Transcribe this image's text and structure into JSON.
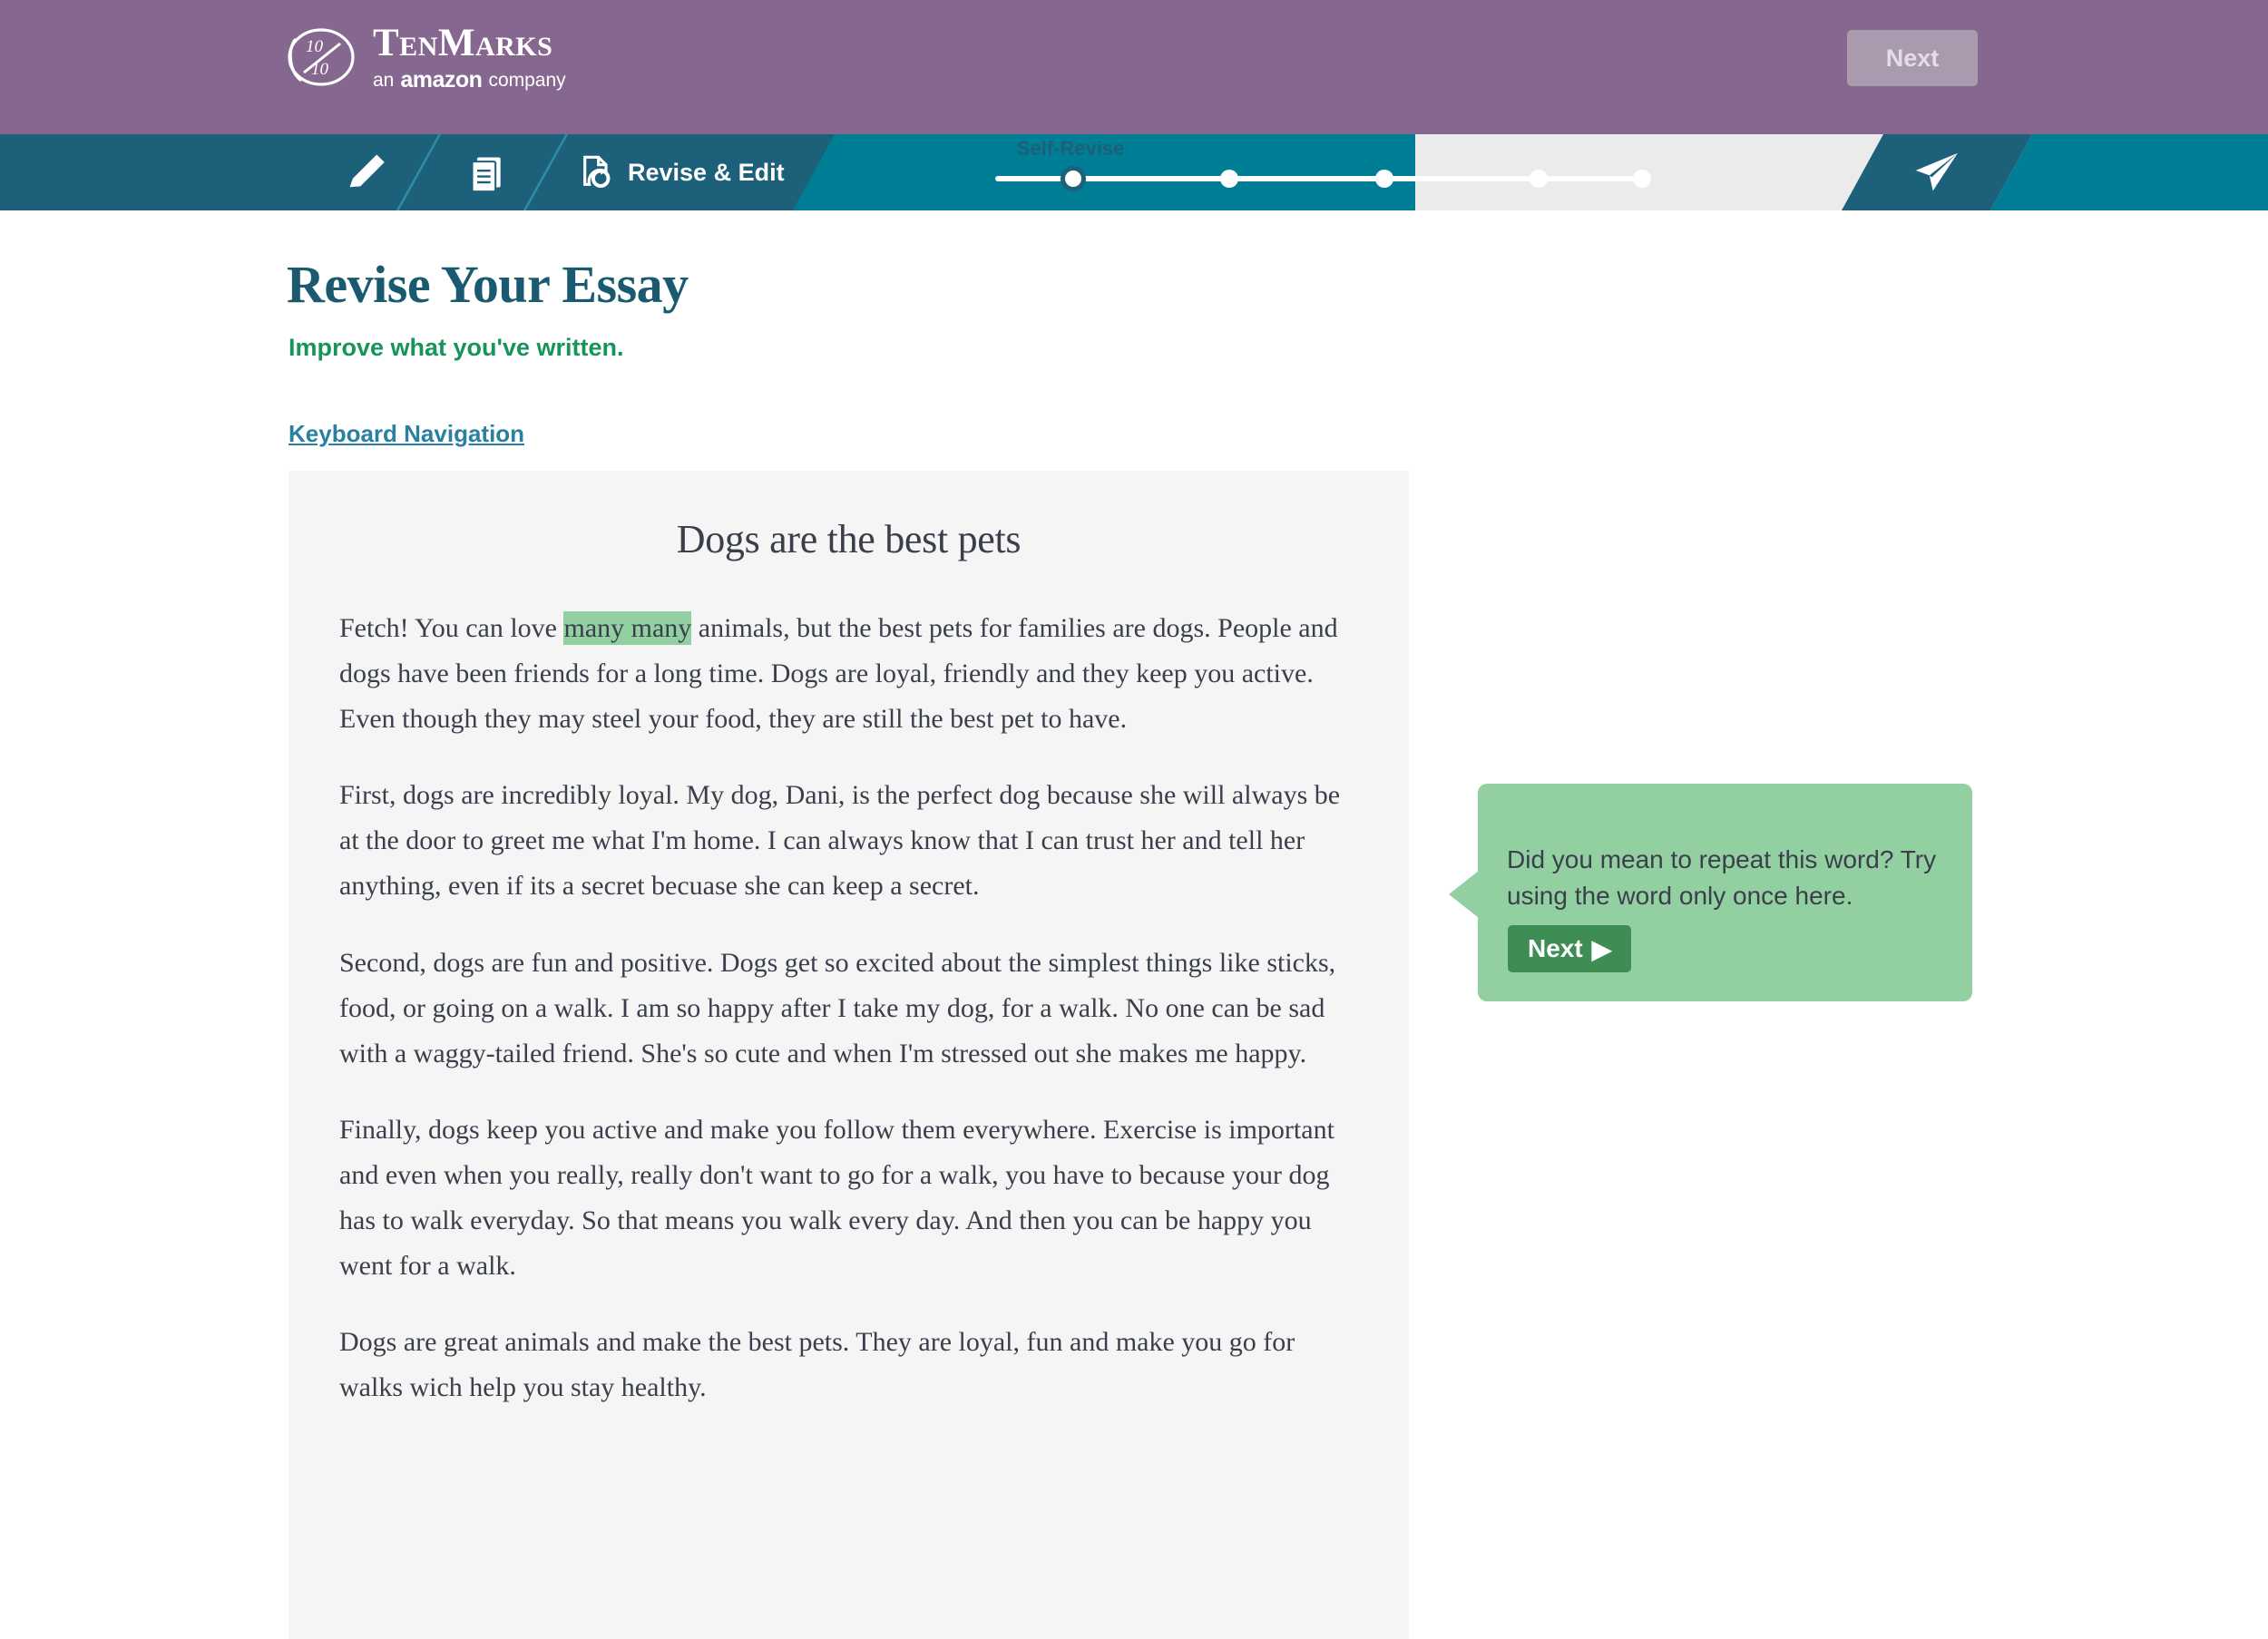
{
  "header": {
    "logo": {
      "mark_text_top": "10",
      "mark_text_bottom": "10",
      "brand": "TenMarks",
      "tagline_prefix": "an",
      "tagline_brand": "amazon",
      "tagline_suffix": "company"
    },
    "next_button": "Next"
  },
  "nav": {
    "items": [
      {
        "icon": "pencil-icon",
        "label": ""
      },
      {
        "icon": "documents-icon",
        "label": ""
      },
      {
        "icon": "revise-document-icon",
        "label": "Revise & Edit"
      }
    ],
    "send_icon": "paper-plane-send-icon",
    "progress": {
      "label": "Self-Revise",
      "total_steps": 5,
      "current_step": 1
    }
  },
  "main": {
    "title": "Revise Your Essay",
    "subtitle": "Improve what you've written.",
    "keyboard_navigation_link": "Keyboard Navigation"
  },
  "essay": {
    "title": "Dogs are the best pets",
    "paragraphs": [
      {
        "before": "Fetch! You can love ",
        "highlight": "many many",
        "after": " animals, but the best pets for families are dogs. People and dogs have been friends for a long time. Dogs are loyal, friendly and they keep you active. Even though they may steel your food, they are still the best pet to have."
      },
      {
        "text": "First, dogs are incredibly loyal. My dog, Dani, is the perfect dog because she will always be at the door to greet me what I'm home. I can always know that I can trust her and tell her anything, even if its a secret becuase she can keep a secret."
      },
      {
        "text": "Second, dogs are fun and positive. Dogs get so excited about the simplest things like sticks, food, or going on a walk. I am so happy after I take my dog, for a walk. No one can be sad with a waggy-tailed friend. She's so cute and when I'm stressed out she makes me happy."
      },
      {
        "text": "Finally, dogs keep you active and make you follow them everywhere. Exercise is important and even when you really, really don't want to go for a walk, you have to because your dog has to walk everyday. So that means you walk every day. And then you can be happy you went for a walk."
      },
      {
        "text": "Dogs are great animals and make the best pets. They are loyal, fun and make you go for walks wich help you stay healthy."
      }
    ]
  },
  "tooltip": {
    "message": "Did you mean to repeat this word? Try using the word only once here.",
    "next_button": "Next",
    "next_arrow": "▶"
  },
  "colors": {
    "header_purple": "#866790",
    "nav_teal": "#007e96",
    "nav_teal_dark": "#1d6079",
    "title_teal": "#1a5a70",
    "subtitle_green": "#16945c",
    "link_blue": "#2980a0",
    "highlight_green": "#92d0a2",
    "tooltip_button_green": "#3e8d55",
    "panel_grey": "#f5f5f5"
  }
}
